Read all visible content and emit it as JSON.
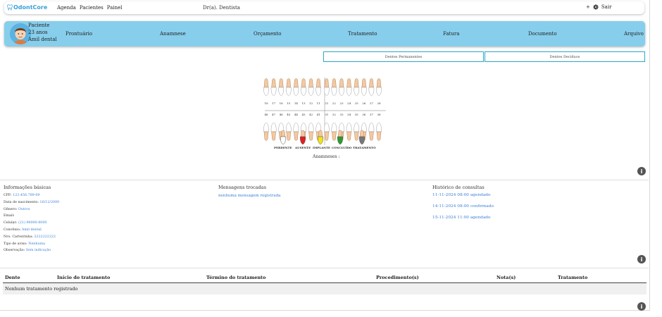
{
  "navbar": {
    "brand": "OdontCore",
    "links": [
      "Agenda",
      "Pacientes",
      "Painel"
    ],
    "doctor": "Dr(a). Dentista",
    "plus": "+",
    "logout": "Sair"
  },
  "patient": {
    "name": "Paciente",
    "age": "23 anos",
    "plan": "Amil dental",
    "tabs": [
      "Prontuário",
      "Anamnese",
      "Orçamento",
      "Tratamento",
      "Fatura",
      "Documento",
      "Arquivo"
    ]
  },
  "teeth_tabs": {
    "permanent": "Dentes Permanentes",
    "deciduous": "Dentes Decíduos"
  },
  "odontogram": {
    "upper_numbers": [
      "18",
      "17",
      "16",
      "15",
      "14",
      "13",
      "12",
      "11",
      "21",
      "22",
      "23",
      "24",
      "25",
      "26",
      "27",
      "28"
    ],
    "lower_numbers": [
      "48",
      "47",
      "46",
      "45",
      "44",
      "43",
      "42",
      "41",
      "31",
      "32",
      "33",
      "34",
      "35",
      "36",
      "37",
      "38"
    ],
    "legend": [
      {
        "label": "PERDENTE",
        "color": "#ffffff"
      },
      {
        "label": "AUSENTE",
        "color": "#e02020"
      },
      {
        "label": "IMPLANTE",
        "color": "#f3e31a"
      },
      {
        "label": "CONCLUÍDO",
        "color": "#2e9a2e"
      },
      {
        "label": "TRATAMENTO",
        "color": "#777777"
      }
    ],
    "anamnese_label": "Anamneses :"
  },
  "info_basica": {
    "title": "Informações básicas",
    "fields": [
      {
        "label": "CPF:",
        "value": "123.456.789-09"
      },
      {
        "label": "Data de nascimento:",
        "value": "16/12/2000"
      },
      {
        "label": "Gênero:",
        "value": "Outros"
      },
      {
        "label": "Email:",
        "value": ""
      },
      {
        "label": "Celular:",
        "value": "(21) 98000-8000"
      },
      {
        "label": "Convênio:",
        "value": "Amil dental"
      },
      {
        "label": "Nro. Carteirinha:",
        "value": "2222222222"
      },
      {
        "label": "Tipo de aviso:",
        "value": "Nenhuma"
      },
      {
        "label": "Observação:",
        "value": "Sem indicação"
      }
    ]
  },
  "mensagens": {
    "title": "Mensagens trocadas",
    "empty": "nenhuma mensagem registrada"
  },
  "historico": {
    "title": "Histórico de consultas",
    "items": [
      "11-11-2024 08:00 agendado",
      "14-11-2024 08:00 confirmado",
      "15-11-2024 11:00 agendado"
    ]
  },
  "tratamentos": {
    "headers": [
      "Dente",
      "Início do tratamento",
      "Término do tratamento",
      "Procedimento(s)",
      "Nota(s)",
      "Tratamento"
    ],
    "empty": "Nenhum tratamento registrado"
  },
  "colors": {
    "accent": "#3a9fd8",
    "patient_bar": "#87ceec",
    "link": "#3a7fd5",
    "tab_border": "#2ba8c8"
  }
}
